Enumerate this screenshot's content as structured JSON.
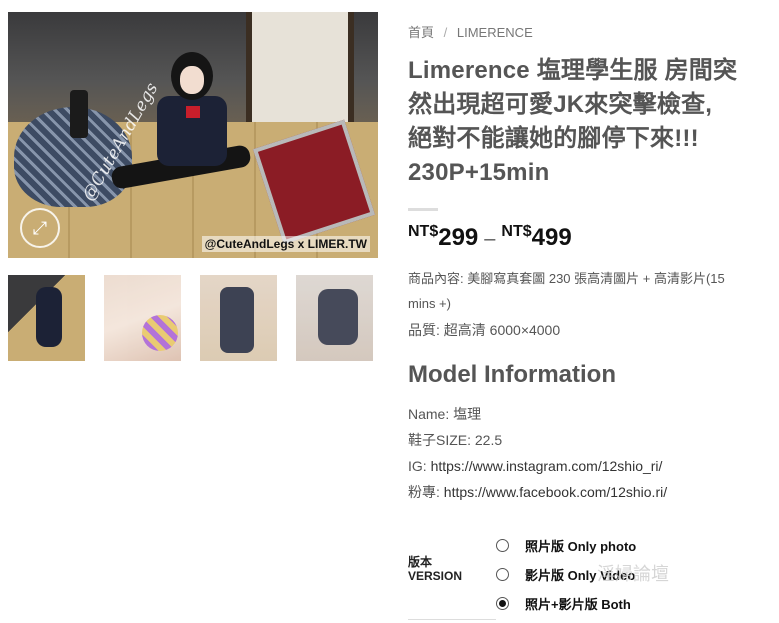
{
  "gallery": {
    "main_image_alt": "Model photo",
    "watermark_left": "@CuteAndLegs",
    "watermark_bottom": "@CuteAndLegs x LIMER.TW",
    "thumbnails": [
      {
        "label": "thumbnail-1"
      },
      {
        "label": "thumbnail-2"
      },
      {
        "label": "thumbnail-3"
      },
      {
        "label": "thumbnail-4"
      }
    ]
  },
  "breadcrumb": {
    "home": "首頁",
    "separator": "/",
    "category": "LIMERENCE"
  },
  "product": {
    "title_line1": "Limerence 塩理學生服 房間突",
    "title_line2": "然出現超可愛JK來突擊檢查,",
    "title_line3": "絕對不能讓她的腳停下來!!!",
    "title_line4": "230P+15min",
    "price_currency_low": "NT$",
    "price_low": "299",
    "price_dash": "–",
    "price_currency_high": "NT$",
    "price_high": "499",
    "content_line1": "商品內容: 美腳寫真套圖 230 張高清圖片 + 高清影片(15",
    "content_line2": "mins +)",
    "quality": "品質: 超高清 6000×4000"
  },
  "model": {
    "heading": "Model Information",
    "name": "Name: 塩理",
    "shoe_size": "鞋子SIZE: 22.5",
    "ig_label": "IG:",
    "ig_url": "https://www.instagram.com/12shio_ri/",
    "fb_label": "粉專:",
    "fb_url": "https://www.facebook.com/12shio.ri/"
  },
  "variations": {
    "label_line1": "版本",
    "label_line2": "VERSION",
    "options": [
      {
        "label": "照片版 Only photo",
        "checked": false
      },
      {
        "label": "影片版 Only Video",
        "checked": false
      },
      {
        "label": "照片+影片版 Both",
        "checked": true
      }
    ]
  },
  "watermark_text": "淫婦論壇",
  "colors": {
    "title_text": "#555555",
    "price_text": "#111111",
    "watermark_pink": "#e0287a"
  }
}
